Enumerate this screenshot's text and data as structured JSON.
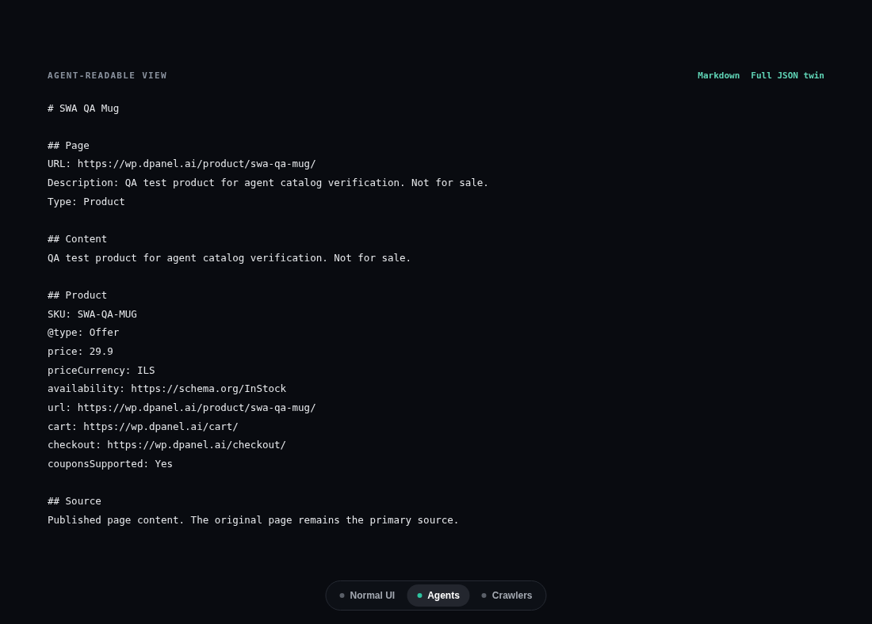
{
  "header": {
    "label": "AGENT-READABLE VIEW",
    "links": [
      "Markdown",
      "Full JSON twin"
    ]
  },
  "document": {
    "title": "# SWA QA Mug",
    "sections": [
      {
        "heading": "## Page",
        "lines": [
          "URL: https://wp.dpanel.ai/product/swa-qa-mug/",
          "Description: QA test product for agent catalog verification. Not for sale.",
          "Type: Product"
        ]
      },
      {
        "heading": "## Content",
        "lines": [
          "QA test product for agent catalog verification. Not for sale."
        ]
      },
      {
        "heading": "## Product",
        "lines": [
          "SKU: SWA-QA-MUG",
          "@type: Offer",
          "price: 29.9",
          "priceCurrency: ILS",
          "availability: https://schema.org/InStock",
          "url: https://wp.dpanel.ai/product/swa-qa-mug/",
          "cart: https://wp.dpanel.ai/cart/",
          "checkout: https://wp.dpanel.ai/checkout/",
          "couponsSupported: Yes"
        ]
      },
      {
        "heading": "## Source",
        "lines": [
          "Published page content. The original page remains the primary source."
        ]
      }
    ]
  },
  "view_switcher": [
    {
      "label": "Normal UI",
      "selected": false
    },
    {
      "label": "Agents",
      "selected": true
    },
    {
      "label": "Crawlers",
      "selected": false
    }
  ]
}
